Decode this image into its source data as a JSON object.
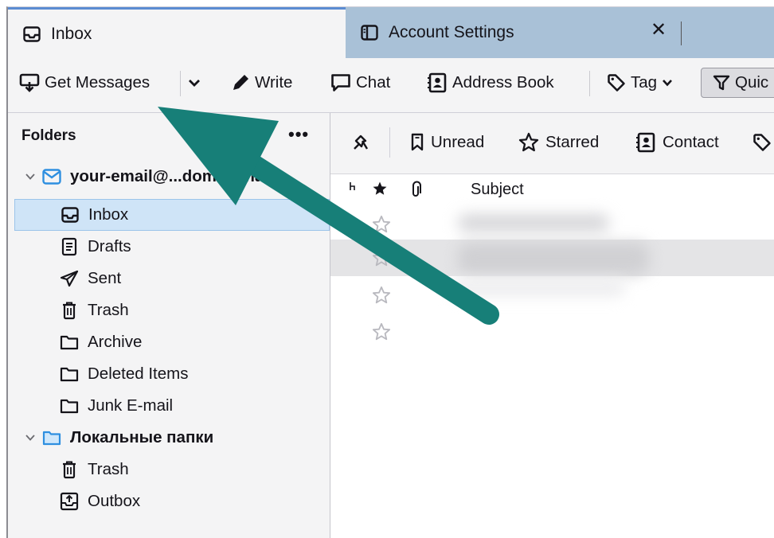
{
  "tabs": [
    {
      "label": "Inbox",
      "icon": "inbox-icon",
      "active": true
    },
    {
      "label": "Account Settings",
      "icon": "account-settings-icon",
      "active": false,
      "close": "✕"
    }
  ],
  "toolbar": {
    "get_messages": "Get Messages",
    "write": "Write",
    "chat": "Chat",
    "address_book": "Address Book",
    "tag": "Tag",
    "quick_filter": "Quic"
  },
  "folders": {
    "header": "Folders",
    "more": "•••",
    "account_email": "your-email@...domain.name",
    "items": [
      {
        "label": "Inbox",
        "icon": "inbox-icon",
        "selected": true
      },
      {
        "label": "Drafts",
        "icon": "drafts-icon"
      },
      {
        "label": "Sent",
        "icon": "sent-icon"
      },
      {
        "label": "Trash",
        "icon": "trash-icon"
      },
      {
        "label": "Archive",
        "icon": "folder-icon"
      },
      {
        "label": "Deleted Items",
        "icon": "folder-icon"
      },
      {
        "label": "Junk E-mail",
        "icon": "folder-icon"
      }
    ],
    "local_account": "Локальные папки",
    "local_items": [
      {
        "label": "Trash",
        "icon": "trash-icon"
      },
      {
        "label": "Outbox",
        "icon": "outbox-icon"
      }
    ]
  },
  "quick_filter": {
    "unread": "Unread",
    "starred": "Starred",
    "contact": "Contact"
  },
  "columns": {
    "subject": "Subject"
  },
  "colors": {
    "tab_strip": "#a9c1d7",
    "selection": "#cfe4f7",
    "arrow": "#177f78",
    "account_icon": "#2e8fe0"
  }
}
